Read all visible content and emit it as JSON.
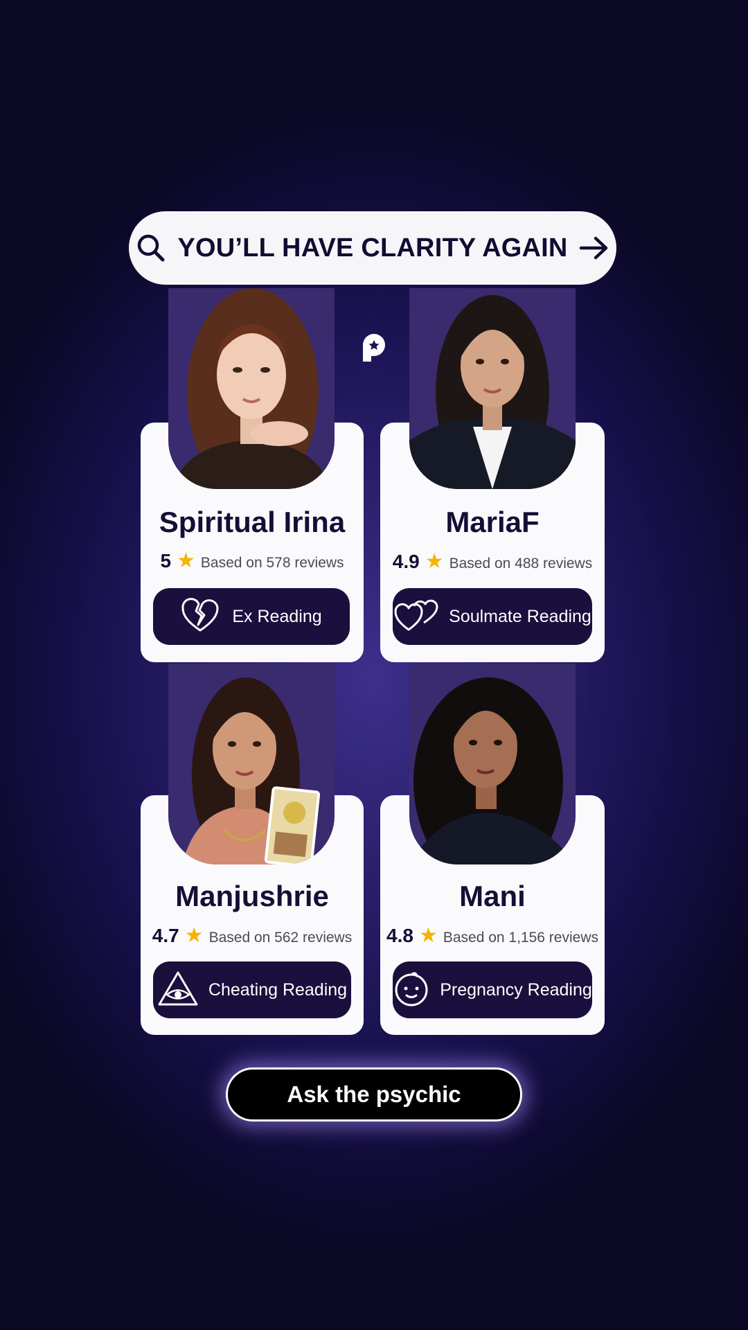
{
  "banner": {
    "text": "YOU’LL HAVE CLARITY AGAIN",
    "icons": [
      "search-icon",
      "arrow-right-icon"
    ]
  },
  "brand": {
    "icon": "brand-logo-icon"
  },
  "psychics": [
    {
      "name": "Spiritual Irina",
      "rating": "5",
      "reviews": "Based on 578 reviews",
      "reading": "Ex Reading",
      "reading_icon": "broken-heart-icon"
    },
    {
      "name": "MariaF",
      "rating": "4.9",
      "reviews": "Based on 488 reviews",
      "reading": "Soulmate Reading",
      "reading_icon": "two-hearts-icon"
    },
    {
      "name": "Manjushrie",
      "rating": "4.7",
      "reviews": "Based on 562 reviews",
      "reading": "Cheating Reading",
      "reading_icon": "eye-triangle-icon"
    },
    {
      "name": "Mani",
      "rating": "4.8",
      "reviews": "Based on 1,156 reviews",
      "reading": "Pregnancy Reading",
      "reading_icon": "baby-face-icon"
    }
  ],
  "cta": {
    "label": "Ask the psychic"
  },
  "colors": {
    "background": "#16104a",
    "card": "#fafafc",
    "button": "#1a0f3d",
    "star": "#f5b400",
    "text": "#150f36"
  }
}
